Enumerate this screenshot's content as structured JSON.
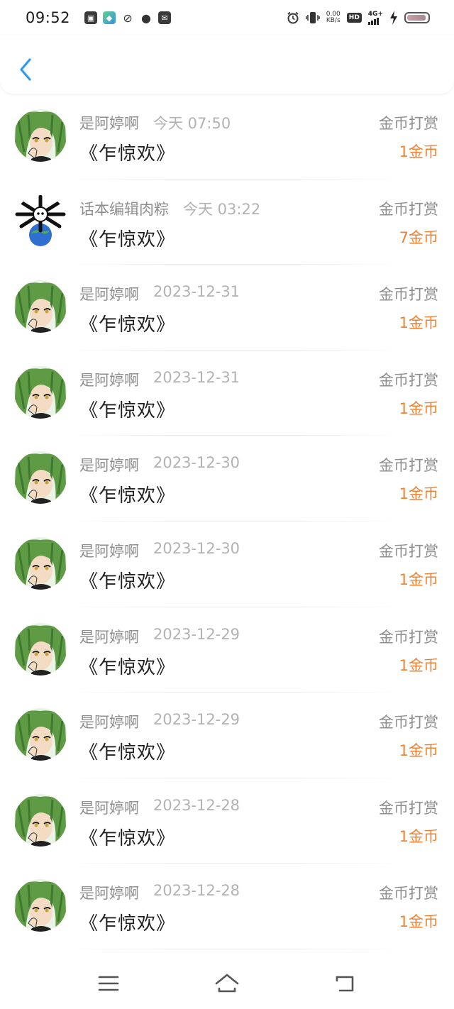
{
  "status_bar": {
    "time": "09:52",
    "net_speed_value": "0.00",
    "net_speed_unit": "KB/s",
    "hd_label": "HD",
    "network_label": "4G+",
    "notification_icons": [
      "nfc-icon",
      "app-store-icon",
      "link-icon",
      "wechat-icon",
      "mail-icon"
    ],
    "right_icons": [
      "alarm-icon",
      "vibrate-icon",
      "charging-icon",
      "battery-icon"
    ]
  },
  "header": {
    "back_icon": "chevron-left-icon",
    "accent_color": "#2f9bf0"
  },
  "colors": {
    "amount": "#f08232",
    "secondary_text": "#8e8e8e",
    "time_text": "#b2b2b2",
    "title_text": "#1f1f1f"
  },
  "rewards": [
    {
      "user": "是阿婷啊",
      "time": "今天 07:50",
      "title": "《乍惊欢》",
      "type": "金币打赏",
      "amount": "1金币",
      "avatar": "green-hair-anime-avatar"
    },
    {
      "user": "话本编辑肉粽",
      "time": "今天 03:22",
      "title": "《乍惊欢》",
      "type": "金币打赏",
      "amount": "7金币",
      "avatar": "globe-skull-avatar"
    },
    {
      "user": "是阿婷啊",
      "time": "2023-12-31",
      "title": "《乍惊欢》",
      "type": "金币打赏",
      "amount": "1金币",
      "avatar": "green-hair-anime-avatar"
    },
    {
      "user": "是阿婷啊",
      "time": "2023-12-31",
      "title": "《乍惊欢》",
      "type": "金币打赏",
      "amount": "1金币",
      "avatar": "green-hair-anime-avatar"
    },
    {
      "user": "是阿婷啊",
      "time": "2023-12-30",
      "title": "《乍惊欢》",
      "type": "金币打赏",
      "amount": "1金币",
      "avatar": "green-hair-anime-avatar"
    },
    {
      "user": "是阿婷啊",
      "time": "2023-12-30",
      "title": "《乍惊欢》",
      "type": "金币打赏",
      "amount": "1金币",
      "avatar": "green-hair-anime-avatar"
    },
    {
      "user": "是阿婷啊",
      "time": "2023-12-29",
      "title": "《乍惊欢》",
      "type": "金币打赏",
      "amount": "1金币",
      "avatar": "green-hair-anime-avatar"
    },
    {
      "user": "是阿婷啊",
      "time": "2023-12-29",
      "title": "《乍惊欢》",
      "type": "金币打赏",
      "amount": "1金币",
      "avatar": "green-hair-anime-avatar"
    },
    {
      "user": "是阿婷啊",
      "time": "2023-12-28",
      "title": "《乍惊欢》",
      "type": "金币打赏",
      "amount": "1金币",
      "avatar": "green-hair-anime-avatar"
    },
    {
      "user": "是阿婷啊",
      "time": "2023-12-28",
      "title": "《乍惊欢》",
      "type": "金币打赏",
      "amount": "1金币",
      "avatar": "green-hair-anime-avatar"
    }
  ],
  "nav_bar": {
    "icons": [
      "menu-icon",
      "home-icon",
      "back-icon"
    ]
  }
}
